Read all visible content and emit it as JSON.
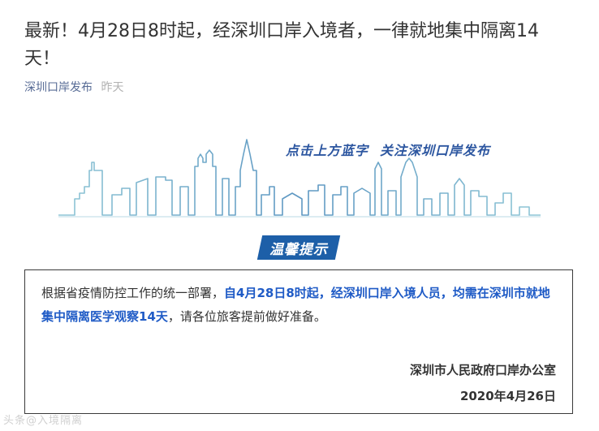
{
  "article": {
    "title": "最新！4月28日8时起，经深圳口岸入境者，一律就地集中隔离14天！",
    "account_name": "深圳口岸发布",
    "time": "昨天"
  },
  "banner": {
    "slogan_part1": "点击上方蓝字",
    "slogan_part2": "关注深圳口岸发布",
    "skyline_color": "#6aa9c9"
  },
  "tip": {
    "label": "温馨提示",
    "color": "#1d5fa8"
  },
  "notice": {
    "text_plain_1": "根据省疫情防控工作的统一部署，",
    "text_highlight": "自4月28日8时起，经深圳口岸入境人员，均需在深圳市就地集中隔离医学观察14天",
    "text_plain_2": "，请各位旅客提前做好准备。",
    "highlight_color": "#1f5bc6",
    "issuer": "深圳市人民政府口岸办公室",
    "date": "2020年4月26日"
  },
  "watermark": {
    "text": "头条@入境隔离"
  }
}
